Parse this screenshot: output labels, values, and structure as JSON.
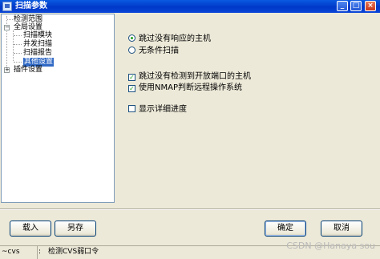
{
  "window": {
    "title": "扫描参数",
    "controls": {
      "minimize": "_",
      "maximize": "□",
      "close": "×"
    }
  },
  "tree": {
    "items": [
      {
        "label": "检测范围",
        "level": 0
      },
      {
        "label": "全局设置",
        "level": 0,
        "expander": "−"
      },
      {
        "label": "扫描模块",
        "level": 1
      },
      {
        "label": "并发扫描",
        "level": 1
      },
      {
        "label": "扫描报告",
        "level": 1
      },
      {
        "label": "其他设置",
        "level": 1,
        "selected": true
      },
      {
        "label": "插件设置",
        "level": 0,
        "expander": "+"
      }
    ]
  },
  "options": {
    "radio_skip": {
      "label": "跳过没有响应的主机",
      "checked": true
    },
    "radio_unconditional": {
      "label": "无条件扫描",
      "checked": false
    },
    "check_skip_ports": {
      "label": "跳过没有检测到开放端口的主机",
      "checked": true
    },
    "check_nmap": {
      "label": "使用NMAP判断远程操作系统",
      "checked": true
    },
    "check_progress": {
      "label": "显示详细进度",
      "checked": false
    }
  },
  "buttons": {
    "load": "载入",
    "save_as": "另存",
    "ok": "确定",
    "cancel": "取消"
  },
  "status_bar": {
    "left": "~cvs",
    "message": "检测CVS弱口令"
  },
  "watermark": "CSDN @Hanaya sou",
  "colors": {
    "titlebar": "#0a46d8",
    "selection": "#316ac5",
    "check_mark": "#21a121"
  }
}
